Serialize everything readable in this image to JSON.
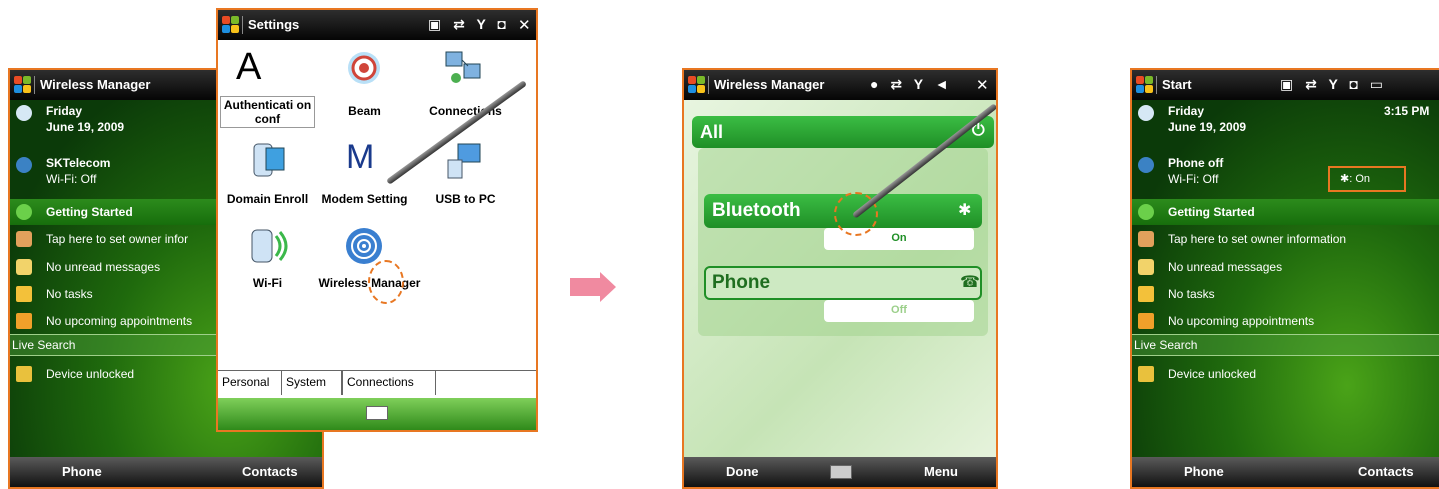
{
  "screen1": {
    "title": "Wireless Manager",
    "items": [
      {
        "line1": "Friday",
        "line2": "June 19, 2009"
      },
      {
        "line1": "SKTelecom",
        "line2": "Wi-Fi: Off"
      },
      {
        "label": "Getting Started"
      },
      {
        "label": "Tap here to set owner infor"
      },
      {
        "label": "No unread messages"
      },
      {
        "label": "No tasks"
      },
      {
        "label": "No upcoming appointments"
      }
    ],
    "live_search": "Live Search",
    "device": "Device unlocked",
    "softkeys": {
      "left": "Phone",
      "right": "Contacts"
    }
  },
  "screen2": {
    "title": "Settings",
    "icons": [
      {
        "label": "Authenticati on conf"
      },
      {
        "label": "Beam"
      },
      {
        "label": "Connections"
      },
      {
        "label": "Domain Enroll"
      },
      {
        "label": "Modem Setting"
      },
      {
        "label": "USB to PC"
      },
      {
        "label": "Wi-Fi"
      },
      {
        "label": "Wireless Manager"
      }
    ],
    "icon_glyphs": {
      "a": "A",
      "m": "M"
    },
    "tabs": [
      "Personal",
      "System",
      "Connections"
    ],
    "active_tab": "Connections"
  },
  "screen3": {
    "title": "Wireless Manager",
    "all": "All",
    "bluetooth": {
      "label": "Bluetooth",
      "state": "On"
    },
    "phone": {
      "label": "Phone",
      "state": "Off"
    },
    "softkeys": {
      "left": "Done",
      "right": "Menu"
    }
  },
  "screen4": {
    "title": "Start",
    "time": "3:15 PM",
    "items": [
      {
        "line1": "Friday",
        "line2": "June 19, 2009"
      },
      {
        "line1": "Phone off",
        "line2": "Wi-Fi: Off"
      },
      {
        "label": "Getting Started"
      },
      {
        "label": "Tap here to set owner information"
      },
      {
        "label": "No unread messages"
      },
      {
        "label": "No tasks"
      },
      {
        "label": "No upcoming appointments"
      }
    ],
    "bt_status": ": On",
    "live_search": "Live Search",
    "device": "Device unlocked",
    "softkeys": {
      "left": "Phone",
      "right": "Contacts"
    }
  },
  "colors": {
    "accent": "#e87722",
    "wm_green": "#24a02c"
  }
}
